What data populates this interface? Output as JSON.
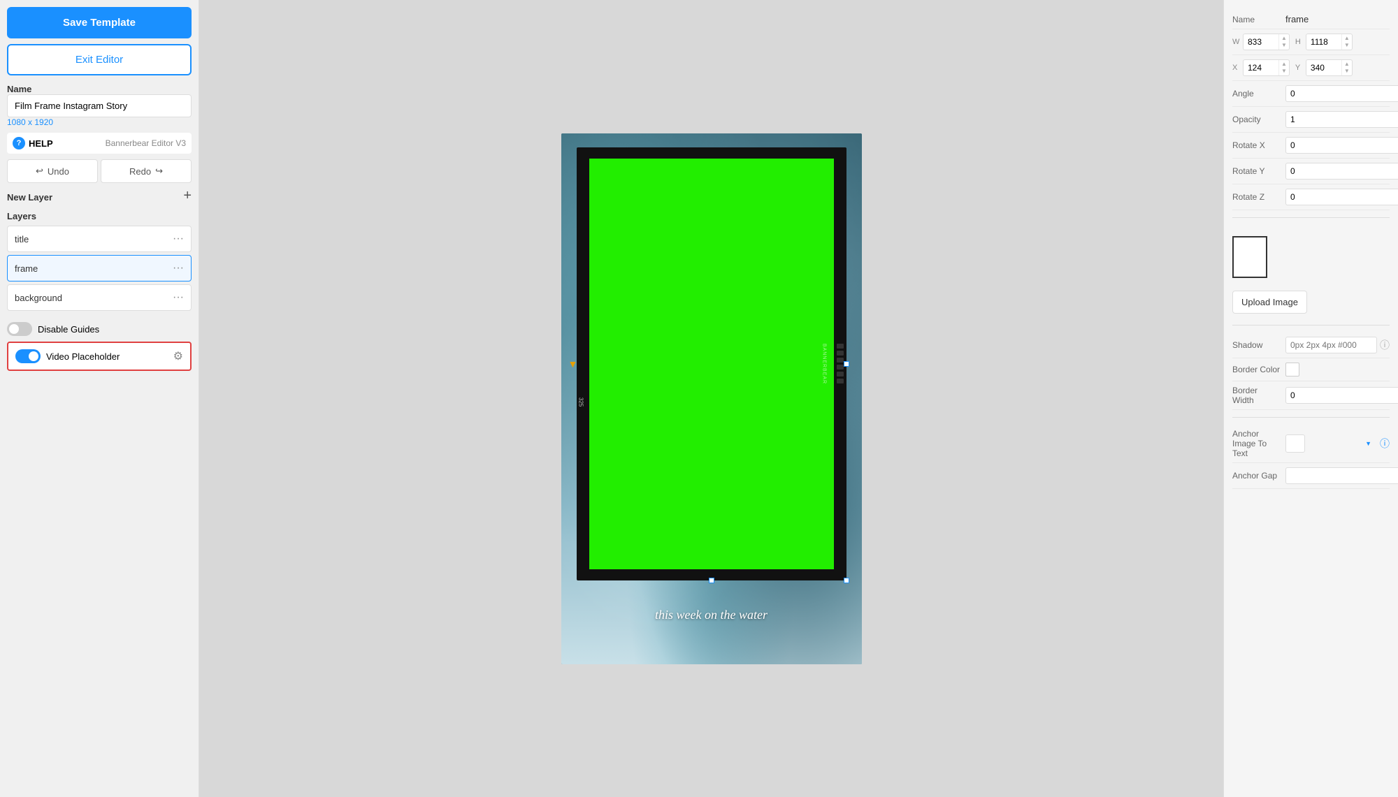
{
  "sidebar": {
    "save_button_label": "Save Template",
    "exit_button_label": "Exit Editor",
    "name_section_label": "Name",
    "template_name_value": "Film Frame Instagram Story",
    "dimensions": "1080 x 1920",
    "help_label": "HELP",
    "help_version": "Bannerbear Editor V3",
    "undo_label": "Undo",
    "redo_label": "Redo",
    "new_layer_label": "New Layer",
    "layers_label": "Layers",
    "layers": [
      {
        "name": "title",
        "active": false
      },
      {
        "name": "frame",
        "active": true
      },
      {
        "name": "background",
        "active": false
      }
    ],
    "disable_guides_label": "Disable Guides",
    "video_placeholder_label": "Video Placeholder"
  },
  "canvas": {
    "caption_text": "this week on the water"
  },
  "right_panel": {
    "name_label": "Name",
    "name_value": "frame",
    "w_label": "W",
    "w_value": "833",
    "h_label": "H",
    "h_value": "1118",
    "x_label": "X",
    "x_value": "124",
    "y_label": "Y",
    "y_value": "340",
    "angle_label": "Angle",
    "angle_value": "0",
    "opacity_label": "Opacity",
    "opacity_value": "1",
    "rotate_x_label": "Rotate X",
    "rotate_x_value": "0",
    "rotate_y_label": "Rotate Y",
    "rotate_y_value": "0",
    "rotate_z_label": "Rotate Z",
    "rotate_z_value": "0",
    "upload_image_label": "Upload Image",
    "shadow_label": "Shadow",
    "shadow_placeholder": "0px 2px 4px #000",
    "border_color_label": "Border Color",
    "border_width_label": "Border Width",
    "border_width_value": "0",
    "anchor_image_label": "Anchor Image To Text",
    "anchor_gap_label": "Anchor Gap",
    "anchor_gap_value": ""
  }
}
